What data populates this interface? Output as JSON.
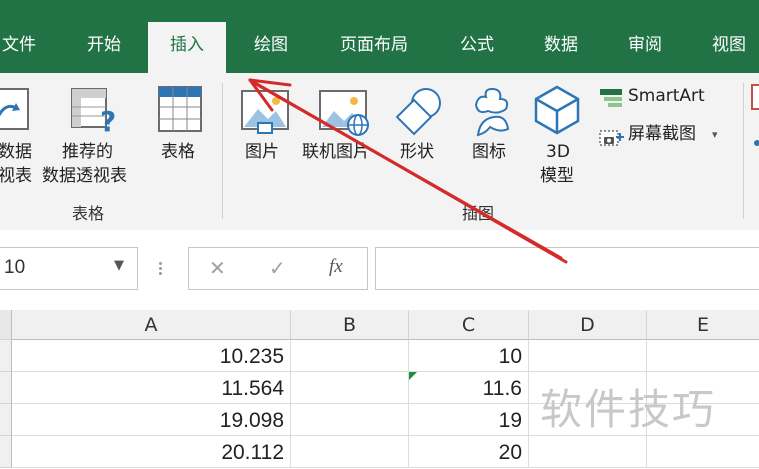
{
  "tabs": [
    "文件",
    "开始",
    "插入",
    "绘图",
    "页面布局",
    "公式",
    "数据",
    "审阅",
    "视图"
  ],
  "active_tab": "插入",
  "ribbon": {
    "pivot_partial_line1": "数据",
    "pivot_partial_line2": "视表",
    "recommended_pivot_line1": "推荐的",
    "recommended_pivot_line2": "数据透视表",
    "table": "表格",
    "group_tables": "表格",
    "pictures": "图片",
    "online_pictures": "联机图片",
    "shapes": "形状",
    "icons": "图标",
    "model3d_line1": "3D",
    "model3d_line2": "模型",
    "smartart": "SmartArt",
    "screenshot": "屏幕截图",
    "group_illustrations": "插图"
  },
  "formula_bar": {
    "name_box": "10",
    "cancel_glyph": "✕",
    "enter_glyph": "✓",
    "fx_glyph": "fx",
    "content": ""
  },
  "sheet": {
    "columns": [
      "A",
      "B",
      "C",
      "D",
      "E"
    ],
    "rows": [
      {
        "a": "10.235",
        "c": "10"
      },
      {
        "a": "11.564",
        "c": "11.6"
      },
      {
        "a": "19.098",
        "c": "19"
      },
      {
        "a": "20.112",
        "c": "20"
      }
    ]
  },
  "watermark": "软件技巧",
  "colors": {
    "excel_green": "#217346",
    "arrow_red": "#d42a2a"
  }
}
